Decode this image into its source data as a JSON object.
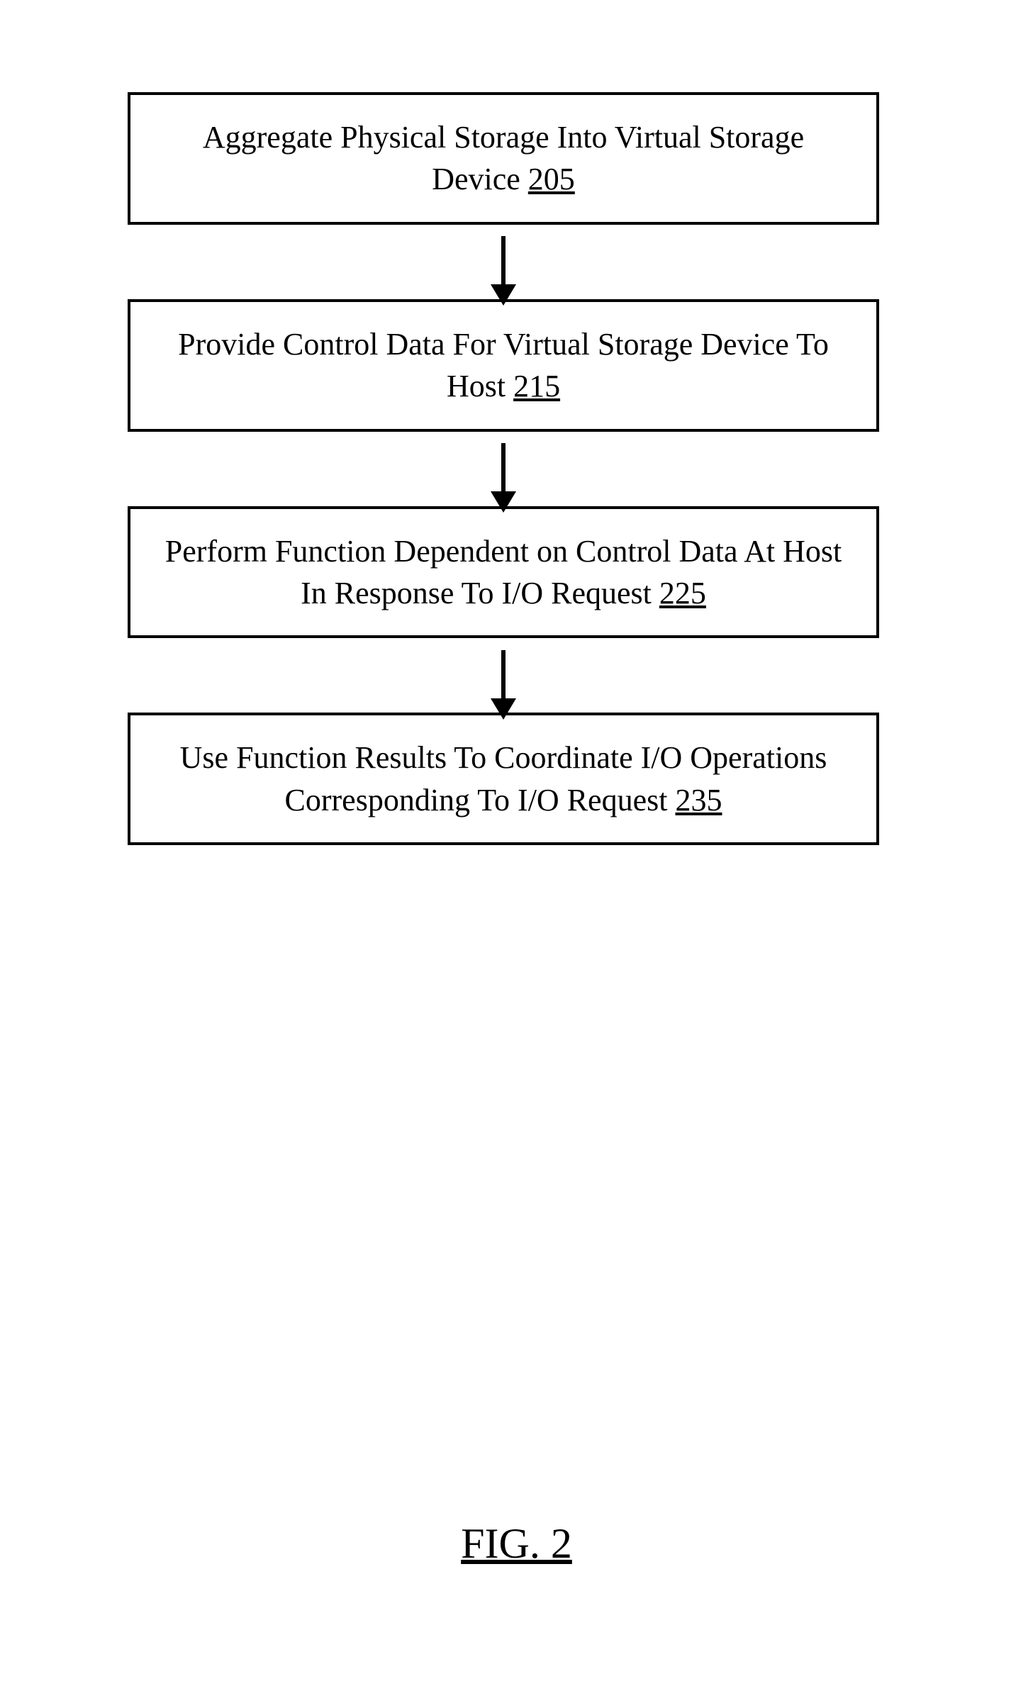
{
  "flowchart": {
    "steps": [
      {
        "text": "Aggregate Physical Storage Into Virtual Storage Device ",
        "ref": "205"
      },
      {
        "text": "Provide Control Data For Virtual Storage Device To Host ",
        "ref": "215"
      },
      {
        "text": "Perform Function Dependent on Control Data At Host In Response To I/O Request ",
        "ref": "225"
      },
      {
        "text": "Use Function Results To Coordinate I/O Operations Corresponding To I/O Request ",
        "ref": "235"
      }
    ]
  },
  "figure_label": "FIG. 2"
}
